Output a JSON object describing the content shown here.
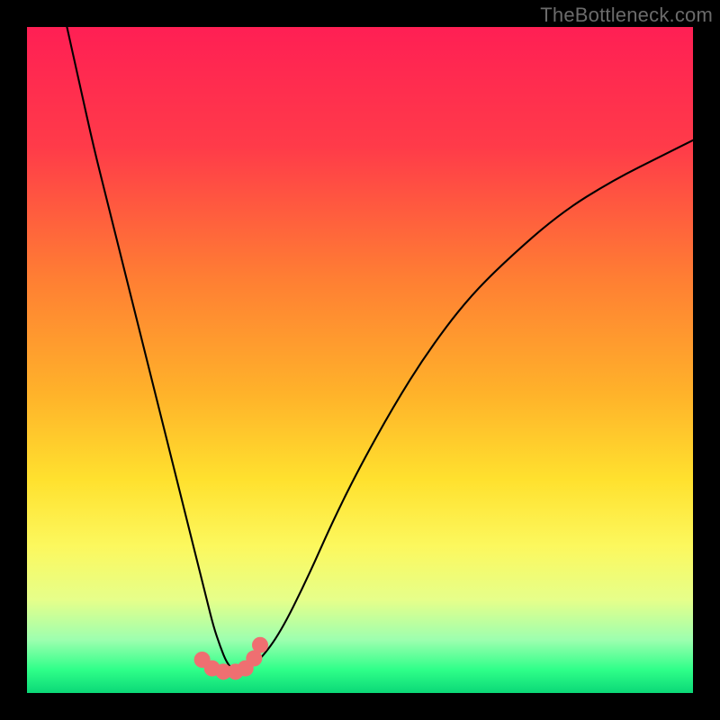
{
  "watermark": "TheBottleneck.com",
  "chart_data": {
    "type": "line",
    "title": "",
    "xlabel": "",
    "ylabel": "",
    "xlim": [
      0,
      100
    ],
    "ylim": [
      0,
      100
    ],
    "gradient_stops": [
      {
        "offset": 0.0,
        "color": "#ff1f54"
      },
      {
        "offset": 0.18,
        "color": "#ff3b49"
      },
      {
        "offset": 0.38,
        "color": "#ff7f33"
      },
      {
        "offset": 0.55,
        "color": "#ffb22a"
      },
      {
        "offset": 0.68,
        "color": "#ffe12e"
      },
      {
        "offset": 0.78,
        "color": "#fcf85e"
      },
      {
        "offset": 0.86,
        "color": "#e6ff8a"
      },
      {
        "offset": 0.92,
        "color": "#9dffaf"
      },
      {
        "offset": 0.965,
        "color": "#2fff89"
      },
      {
        "offset": 1.0,
        "color": "#0bd877"
      }
    ],
    "series": [
      {
        "name": "bottleneck-curve",
        "type": "line",
        "color": "#000000",
        "width": 2.1,
        "x": [
          6,
          8,
          10,
          12,
          14,
          16,
          18,
          20,
          22,
          24,
          26,
          27,
          28,
          29,
          30,
          31,
          32,
          33,
          35,
          38,
          42,
          46,
          50,
          55,
          60,
          66,
          72,
          80,
          88,
          96,
          100
        ],
        "y": [
          100,
          91,
          82,
          74,
          66,
          58,
          50,
          42,
          34,
          26,
          18,
          14,
          10,
          7,
          4.5,
          3.5,
          3.2,
          3.5,
          5,
          9,
          17,
          26,
          34,
          43,
          51,
          59,
          65,
          72,
          77,
          81,
          83
        ]
      },
      {
        "name": "bottom-markers",
        "type": "scatter",
        "color": "#ef6f71",
        "radius": 9,
        "x": [
          26.3,
          27.8,
          29.5,
          31.3,
          32.8,
          34.1,
          35.0
        ],
        "y": [
          5.0,
          3.7,
          3.2,
          3.2,
          3.7,
          5.2,
          7.2
        ]
      }
    ]
  }
}
